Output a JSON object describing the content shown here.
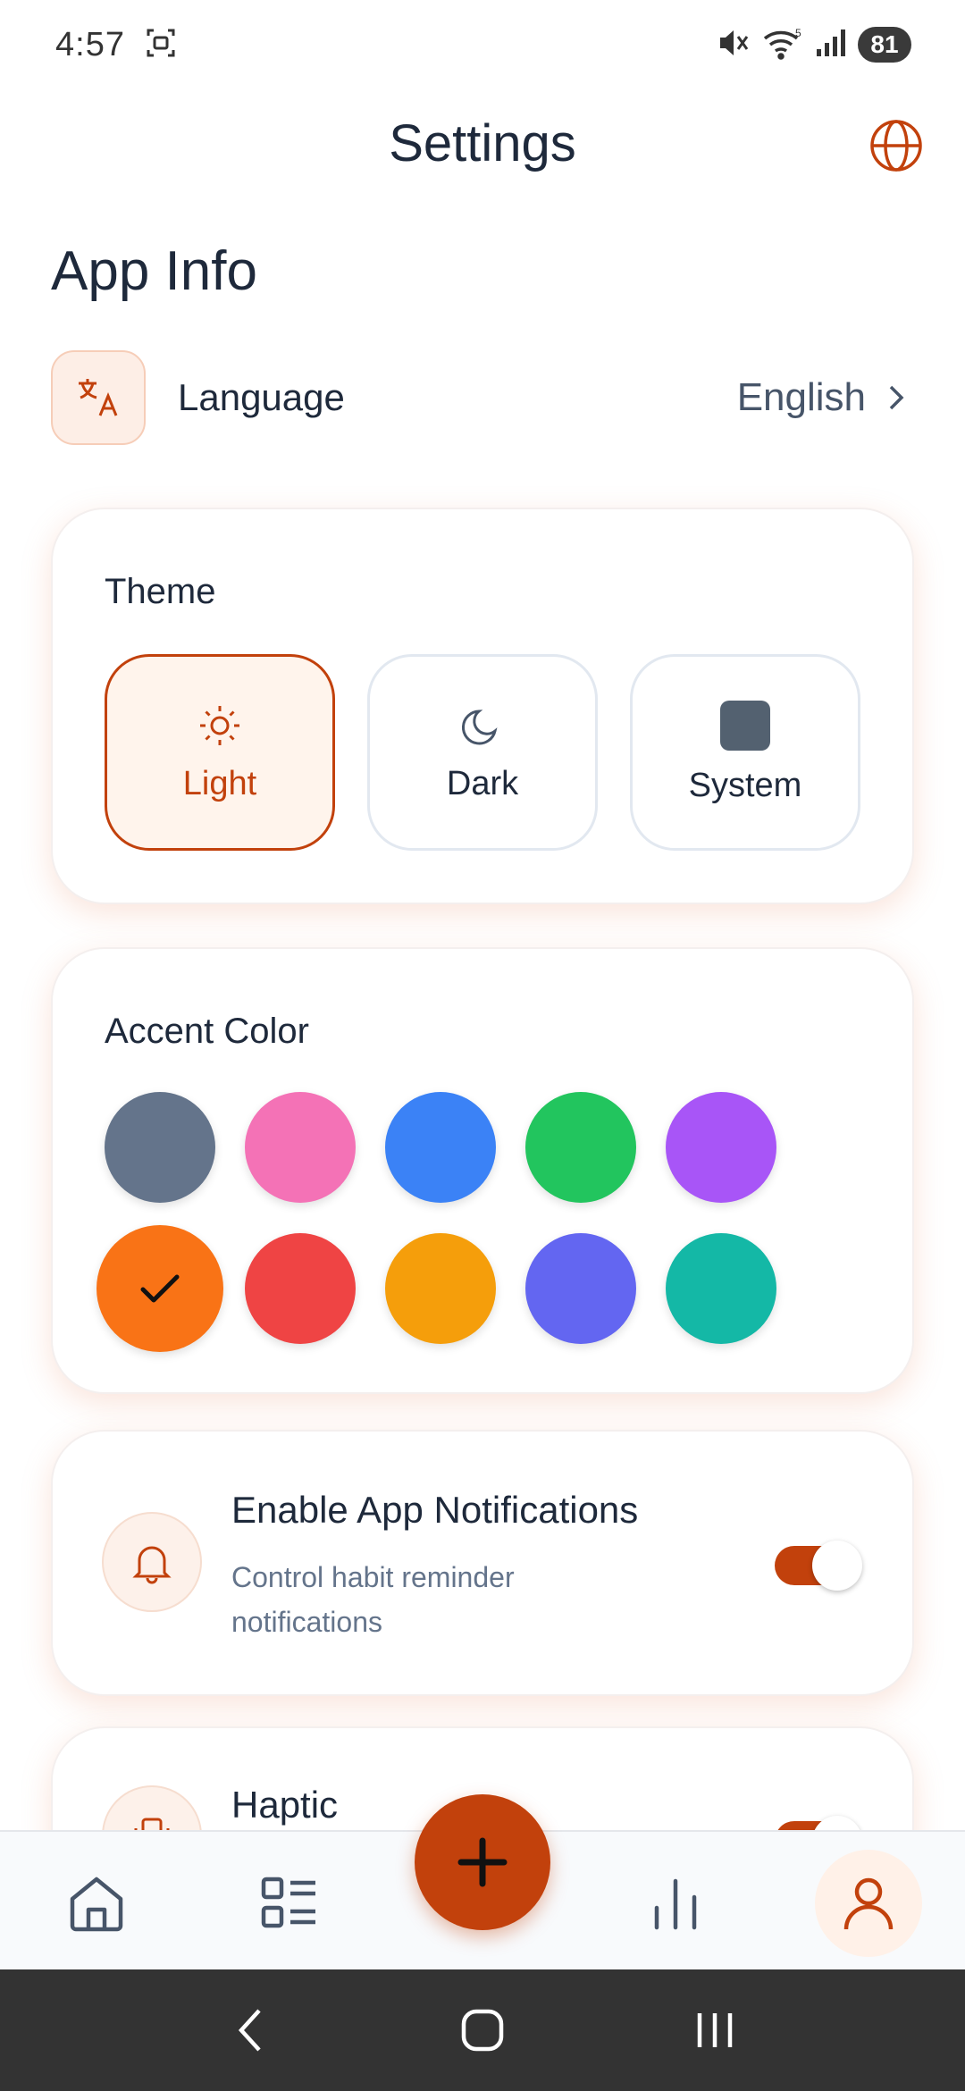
{
  "status_bar": {
    "time": "4:57",
    "battery": "81",
    "network_badge": "5"
  },
  "header": {
    "title": "Settings"
  },
  "app_info": {
    "section_title": "App Info",
    "language": {
      "label": "Language",
      "value": "English"
    }
  },
  "theme": {
    "title": "Theme",
    "options": [
      {
        "label": "Light",
        "icon": "sun-icon",
        "selected": true
      },
      {
        "label": "Dark",
        "icon": "moon-icon",
        "selected": false
      },
      {
        "label": "System",
        "icon": "square-icon",
        "selected": false
      }
    ]
  },
  "accent": {
    "title": "Accent Color",
    "colors": [
      "#64748b",
      "#f472b6",
      "#3b82f6",
      "#22c55e",
      "#a855f7",
      "#f97316",
      "#ef4444",
      "#f59e0b",
      "#6366f1",
      "#14b8a6"
    ],
    "selected_color": "#f97316"
  },
  "notifications": {
    "title": "Enable App Notifications",
    "description": "Control habit reminder notifications",
    "enabled": true
  },
  "haptic": {
    "title": "Haptic",
    "enabled": true
  },
  "colors": {
    "primary": "#c2410c",
    "text": "#1e293b",
    "muted": "#64748b"
  },
  "bottom_nav": {
    "items": [
      "home-icon",
      "habits-list-icon",
      "add-icon",
      "stats-icon",
      "profile-icon"
    ],
    "active": "profile-icon"
  }
}
